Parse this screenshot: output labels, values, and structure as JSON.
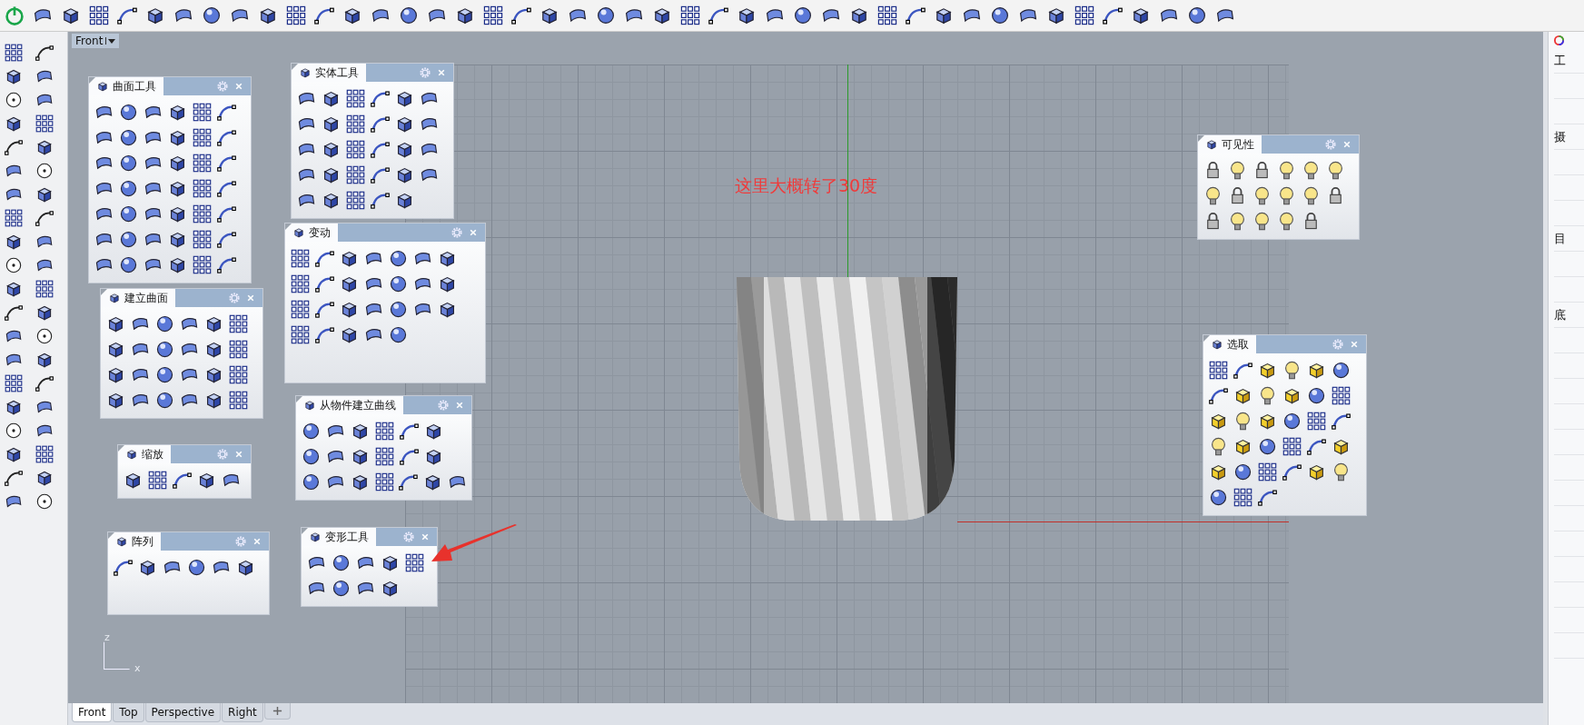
{
  "viewport": {
    "title": "Front"
  },
  "palettes": [
    {
      "title": "曲面工具"
    },
    {
      "title": "实体工具"
    },
    {
      "title": "变动"
    },
    {
      "title": "建立曲面"
    },
    {
      "title": "从物件建立曲线"
    },
    {
      "title": "缩放"
    },
    {
      "title": "阵列"
    },
    {
      "title": "变形工具"
    },
    {
      "title": "可见性"
    },
    {
      "title": "选取"
    }
  ],
  "annotation": "这里大概转了30度",
  "axis_labels": [
    "z",
    "x"
  ],
  "viewport_tabs": [
    {
      "label": "Front",
      "selected": true
    },
    {
      "label": "Top",
      "selected": false
    },
    {
      "label": "Perspective",
      "selected": false
    },
    {
      "label": "Right",
      "selected": false
    }
  ],
  "side_panel": {
    "labels": [
      "工",
      "摄",
      "目",
      "底"
    ]
  }
}
